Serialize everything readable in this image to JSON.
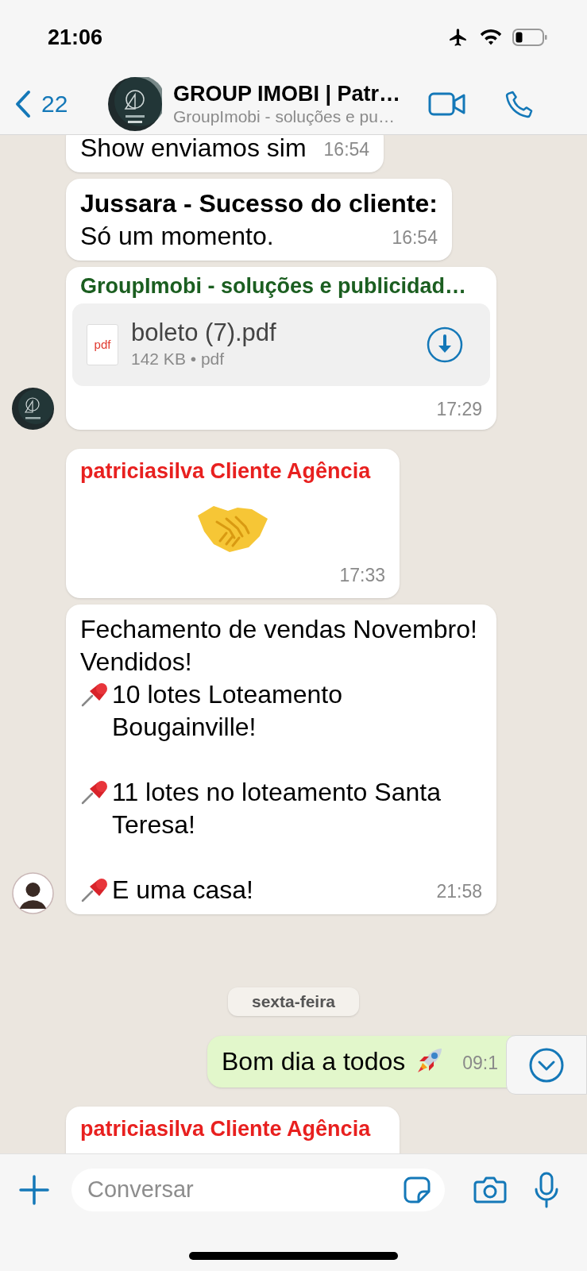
{
  "status_bar": {
    "time": "21:06"
  },
  "header": {
    "back_count": "22",
    "title": "GROUP IMOBI | Patr…",
    "subtitle": "GroupImobi - soluções e pu…"
  },
  "messages": [
    {
      "kind": "text",
      "paragraphs": [
        [
          {
            "text": "Show enviamos sim"
          }
        ]
      ],
      "time": "16:54"
    },
    {
      "kind": "text",
      "paragraphs": [
        [
          {
            "text": "Jussara - Sucesso do cliente:",
            "bold": true
          },
          {
            "text": "Só um momento."
          }
        ]
      ],
      "time": "16:54"
    },
    {
      "kind": "file",
      "sender": "GroupImobi - soluções e publicidad…",
      "color": "#1b5e20",
      "file": {
        "type_label": "pdf",
        "name": "boleto (7).pdf",
        "meta": "142 KB • pdf"
      },
      "time": "17:29",
      "avatar": true
    },
    {
      "kind": "handshake",
      "sender": "patriciasilva Cliente Agência",
      "color": "#e8201f",
      "time": "17:33"
    },
    {
      "kind": "text",
      "paragraphs": [
        [
          {
            "text": "Fechamento de vendas Novembro!"
          },
          {
            "text": "Vendidos!"
          },
          {
            "text": "10 lotes Loteamento Bougainville!",
            "pin": true
          }
        ],
        [
          {
            "text": "11 lotes no loteamento Santa Teresa!",
            "pin": true
          }
        ],
        [
          {
            "text": "E uma casa!",
            "pin": true
          }
        ]
      ],
      "time": "21:58",
      "avatar": true
    },
    {
      "kind": "date",
      "text": "sexta-feira"
    },
    {
      "kind": "outgoing",
      "paragraphs": [
        [
          {
            "text": "Bom dia a todos",
            "rocket": true
          }
        ]
      ],
      "time": "09:1"
    },
    {
      "kind": "partial",
      "sender": "patriciasilva Cliente Agência",
      "color": "#e8201f"
    }
  ],
  "composer": {
    "placeholder": "Conversar"
  }
}
